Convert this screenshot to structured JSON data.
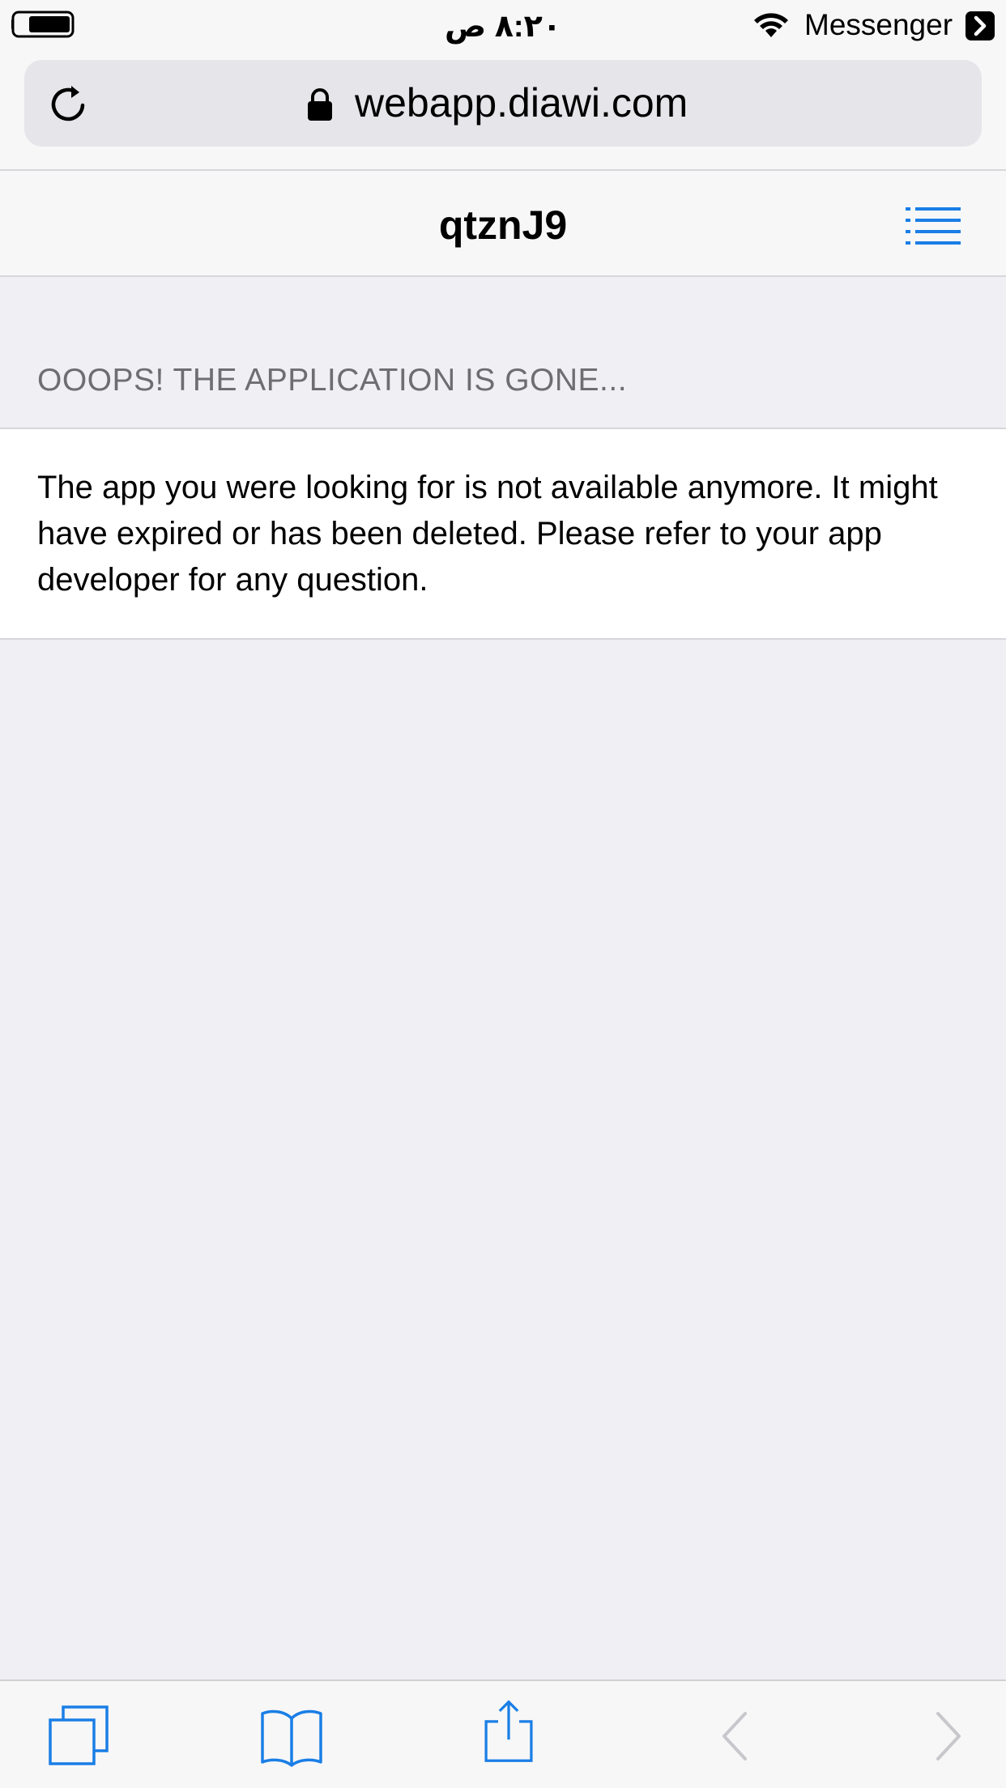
{
  "status_bar": {
    "time": "٨:٢٠ ص",
    "back_app": "Messenger"
  },
  "browser": {
    "url": "webapp.diawi.com"
  },
  "navbar": {
    "title": "qtznJ9"
  },
  "section": {
    "header": "OOOPS! THE APPLICATION IS GONE...",
    "message": "The app you were looking for is not available anymore. It might have expired or has been deleted. Please refer to your app developer for any question."
  },
  "colors": {
    "accent": "#1a7ee6",
    "background": "#efeff4",
    "disabled": "#c7c7cc"
  },
  "icons": {
    "reload": "reload-icon",
    "lock": "lock-icon",
    "menu": "list-menu-icon",
    "tabs": "tabs-icon",
    "bookmarks": "book-icon",
    "share": "share-icon",
    "back": "chevron-left-icon",
    "forward": "chevron-right-icon"
  }
}
